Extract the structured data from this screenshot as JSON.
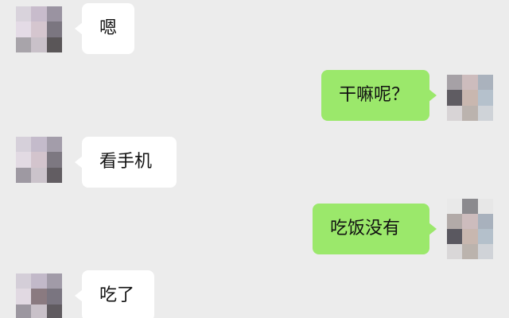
{
  "messages": [
    {
      "side": "in",
      "text": "嗯"
    },
    {
      "side": "out",
      "text": "干嘛呢？"
    },
    {
      "side": "in",
      "text": "看手机"
    },
    {
      "side": "out",
      "text": "吃饭没有"
    },
    {
      "side": "in",
      "text": "吃了"
    }
  ],
  "colors": {
    "background": "#ececec",
    "incoming_bubble": "#ffffff",
    "outgoing_bubble": "#9be86b",
    "text": "#111111"
  }
}
